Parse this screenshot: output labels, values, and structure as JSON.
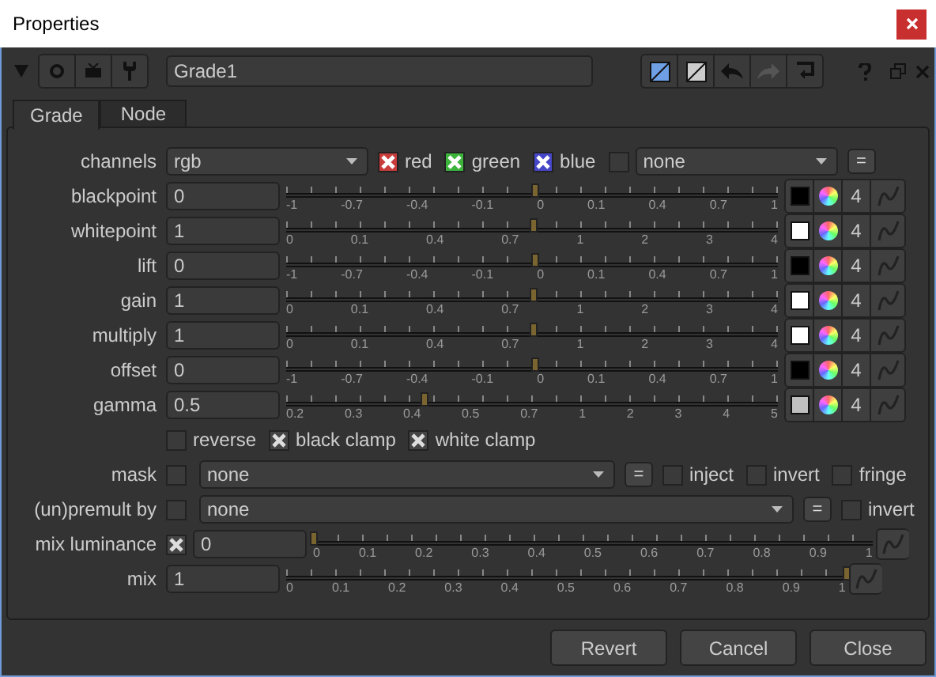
{
  "window": {
    "title": "Properties"
  },
  "node": {
    "name": "Grade1"
  },
  "tabs": [
    {
      "label": "Grade",
      "selected": true
    },
    {
      "label": "Node",
      "selected": false
    }
  ],
  "channels": {
    "label": "channels",
    "value": "rgb",
    "options": [
      {
        "label": "red",
        "checked": true,
        "color": "#c83c3c"
      },
      {
        "label": "green",
        "checked": true,
        "color": "#3cb43c"
      },
      {
        "label": "blue",
        "checked": true,
        "color": "#4646c8"
      }
    ],
    "extra_checked": false,
    "extra_value": "none",
    "link": "="
  },
  "knobs": [
    {
      "label": "blackpoint",
      "value": "0",
      "level": 0.505,
      "color": "#000000",
      "count": "4",
      "ticks": [
        "-1",
        "-0.7",
        "-0.4",
        "-0.1",
        "0",
        "0.1",
        "0.4",
        "0.7",
        "1"
      ]
    },
    {
      "label": "whitepoint",
      "value": "1",
      "level": 0.5,
      "color": "#ffffff",
      "count": "4",
      "ticks": [
        "0",
        "0.1",
        "0.4",
        "0.7",
        "1",
        "2",
        "3",
        "4"
      ]
    },
    {
      "label": "lift",
      "value": "0",
      "level": 0.505,
      "color": "#000000",
      "count": "4",
      "ticks": [
        "-1",
        "-0.7",
        "-0.4",
        "-0.1",
        "0",
        "0.1",
        "0.4",
        "0.7",
        "1"
      ]
    },
    {
      "label": "gain",
      "value": "1",
      "level": 0.5,
      "color": "#ffffff",
      "count": "4",
      "ticks": [
        "0",
        "0.1",
        "0.4",
        "0.7",
        "1",
        "2",
        "3",
        "4"
      ]
    },
    {
      "label": "multiply",
      "value": "1",
      "level": 0.5,
      "color": "#ffffff",
      "count": "4",
      "ticks": [
        "0",
        "0.1",
        "0.4",
        "0.7",
        "1",
        "2",
        "3",
        "4"
      ]
    },
    {
      "label": "offset",
      "value": "0",
      "level": 0.505,
      "color": "#000000",
      "count": "4",
      "ticks": [
        "-1",
        "-0.7",
        "-0.4",
        "-0.1",
        "0",
        "0.1",
        "0.4",
        "0.7",
        "1"
      ]
    },
    {
      "label": "gamma",
      "value": "0.5",
      "level": 0.28,
      "color": "#c0c0c0",
      "count": "4",
      "ticks": [
        "0.2",
        "0.3",
        "0.4",
        "0.5",
        "0.7",
        "1",
        "2",
        "3",
        "4",
        "5"
      ]
    }
  ],
  "clamps": [
    {
      "label": "reverse",
      "checked": false
    },
    {
      "label": "black clamp",
      "checked": true
    },
    {
      "label": "white clamp",
      "checked": true
    }
  ],
  "mask": {
    "label": "mask",
    "enabled": false,
    "value": "none",
    "link": "=",
    "options": [
      {
        "label": "inject",
        "checked": false
      },
      {
        "label": "invert",
        "checked": false
      },
      {
        "label": "fringe",
        "checked": false
      }
    ]
  },
  "premult": {
    "label": "(un)premult by",
    "enabled": false,
    "value": "none",
    "link": "=",
    "options": [
      {
        "label": "invert",
        "checked": false
      }
    ]
  },
  "mix_luminance": {
    "label": "mix luminance",
    "enabled": true,
    "value": "0",
    "level": 0,
    "ticks": [
      "0",
      "0.1",
      "0.2",
      "0.3",
      "0.4",
      "0.5",
      "0.6",
      "0.7",
      "0.8",
      "0.9",
      "1"
    ]
  },
  "mix": {
    "label": "mix",
    "value": "1",
    "level": 1,
    "ticks": [
      "0",
      "0.1",
      "0.2",
      "0.3",
      "0.4",
      "0.5",
      "0.6",
      "0.7",
      "0.8",
      "0.9",
      "1"
    ]
  },
  "buttons": [
    "Revert",
    "Cancel",
    "Close"
  ]
}
